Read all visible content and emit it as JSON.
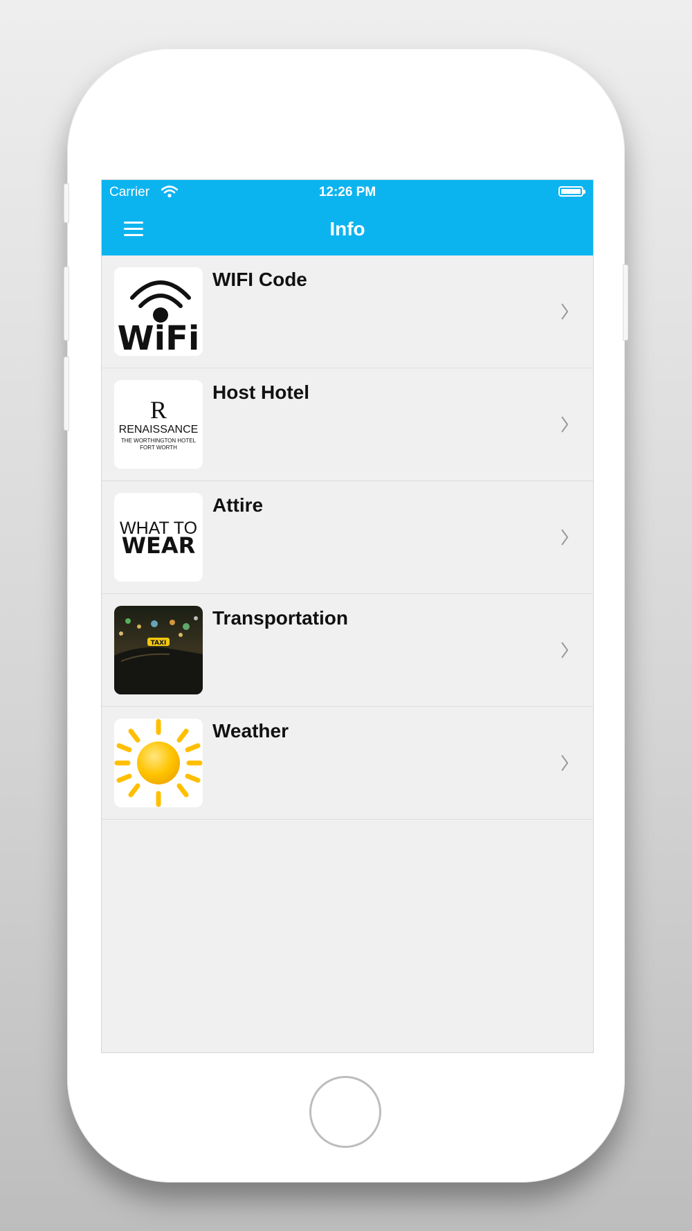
{
  "status_bar": {
    "carrier": "Carrier",
    "time": "12:26 PM",
    "wifi_icon": "wifi-icon",
    "battery_icon": "battery-full-icon"
  },
  "nav": {
    "title": "Info",
    "menu_icon": "hamburger-menu-icon"
  },
  "theme": {
    "accent": "#0cb4ef",
    "list_background": "#f0f0f0",
    "sun_color": "#ffbf00"
  },
  "items": [
    {
      "title": "WIFI Code",
      "thumb_text": "WiFi",
      "thumb_icon": "wifi-logo"
    },
    {
      "title": "Host Hotel",
      "thumb_mark": "R",
      "thumb_brand": "RENAISSANCE",
      "thumb_sub1": "THE WORTHINGTON HOTEL",
      "thumb_sub2": "FORT WORTH",
      "thumb_icon": "hotel-logo"
    },
    {
      "title": "Attire",
      "thumb_line1": "WHAT TO",
      "thumb_line2": "WEAR",
      "thumb_icon": "what-to-wear-logo"
    },
    {
      "title": "Transportation",
      "thumb_sign": "TAXI",
      "thumb_icon": "taxi-photo"
    },
    {
      "title": "Weather",
      "thumb_icon": "sun-icon"
    }
  ]
}
